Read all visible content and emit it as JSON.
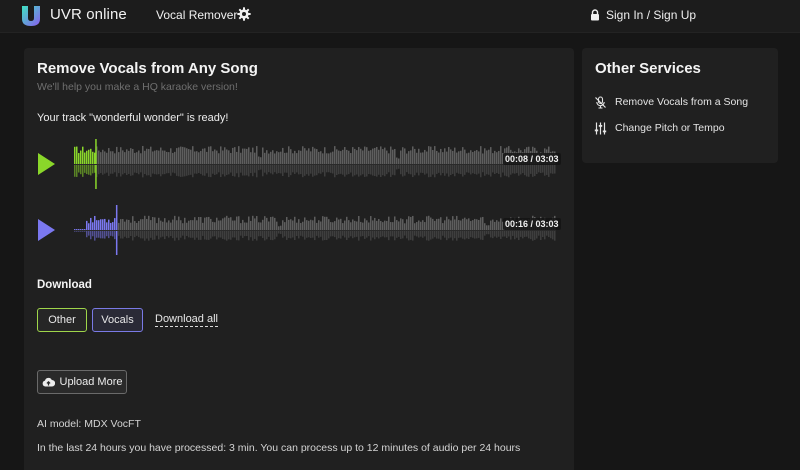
{
  "header": {
    "brand": "UVR online",
    "nav_vocal_remover": "Vocal Remover",
    "signin": "Sign In / Sign Up",
    "accent_color": "#8a5cf0"
  },
  "main": {
    "title": "Remove Vocals from Any Song",
    "subtitle": "We'll help you make a HQ karaoke version!",
    "ready_text": "Your track \"wonderful wonder\" is ready!",
    "tracks": [
      {
        "name": "Other",
        "time": "00:08 / 03:03",
        "progress": 0.044,
        "color": "#8ad72a",
        "icon": "play-icon"
      },
      {
        "name": "Vocals",
        "time": "00:16 / 03:03",
        "progress": 0.087,
        "color": "#7b78f0",
        "icon": "play-icon"
      }
    ],
    "download_heading": "Download",
    "download_buttons": {
      "other": "Other",
      "vocals": "Vocals",
      "all": "Download all"
    },
    "upload_more": "Upload More",
    "ai_model": "AI model: MDX VocFT",
    "usage": "In the last 24 hours you have processed: 3 min. You can process up to 12 minutes of audio per 24 hours"
  },
  "sidebar": {
    "title": "Other Services",
    "items": [
      {
        "label": "Remove Vocals from a Song",
        "icon": "mic-off-icon"
      },
      {
        "label": "Change Pitch or Tempo",
        "icon": "sliders-icon"
      }
    ]
  }
}
